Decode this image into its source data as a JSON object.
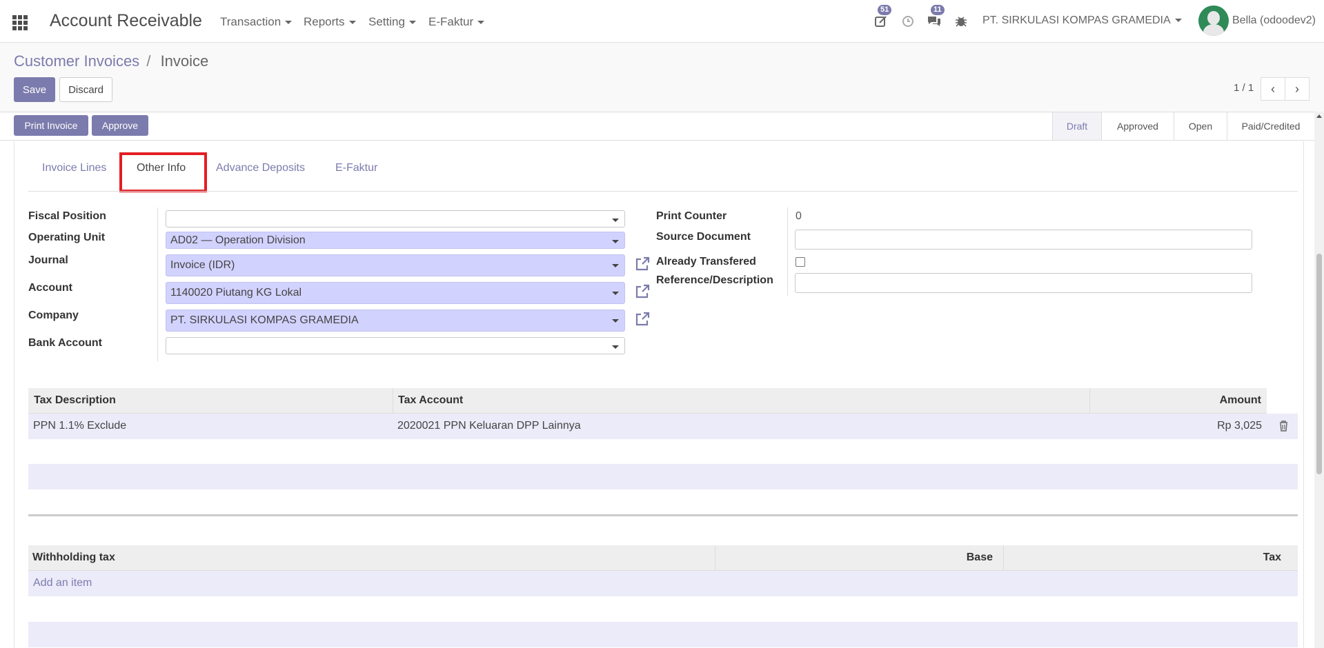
{
  "nav": {
    "app_title": "Account Receivable",
    "menus": [
      "Transaction",
      "Reports",
      "Setting",
      "E-Faktur"
    ],
    "activities_badge": "51",
    "messages_badge": "11",
    "company": "PT. SIRKULASI KOMPAS GRAMEDIA",
    "user": "Bella (odoodev2)"
  },
  "breadcrumb": {
    "parent": "Customer Invoices",
    "separator": "/",
    "current": "Invoice"
  },
  "buttons": {
    "save": "Save",
    "discard": "Discard",
    "print_invoice": "Print Invoice",
    "approve": "Approve"
  },
  "pager": {
    "value": "1 / 1"
  },
  "stages": [
    "Draft",
    "Approved",
    "Open",
    "Paid/Credited"
  ],
  "active_stage": "Draft",
  "tabs": [
    "Invoice Lines",
    "Other Info",
    "Advance Deposits",
    "E-Faktur"
  ],
  "active_tab": "Other Info",
  "form_left": {
    "fiscal_position": {
      "label": "Fiscal Position",
      "value": ""
    },
    "operating_unit": {
      "label": "Operating Unit",
      "value": "AD02 — Operation Division"
    },
    "journal": {
      "label": "Journal",
      "value": "Invoice (IDR)"
    },
    "account": {
      "label": "Account",
      "value": "1140020 Piutang KG Lokal"
    },
    "company": {
      "label": "Company",
      "value": "PT. SIRKULASI KOMPAS GRAMEDIA"
    },
    "bank_account": {
      "label": "Bank Account",
      "value": ""
    }
  },
  "form_right": {
    "print_counter": {
      "label": "Print Counter",
      "value": "0"
    },
    "source_document": {
      "label": "Source Document",
      "value": ""
    },
    "already_transfered": {
      "label": "Already Transfered",
      "checked": false
    },
    "reference": {
      "label": "Reference/Description",
      "value": ""
    }
  },
  "tax_table": {
    "headers": [
      "Tax Description",
      "Tax Account",
      "Amount"
    ],
    "rows": [
      {
        "description": "PPN 1.1% Exclude",
        "account": "2020021 PPN Keluaran DPP Lainnya",
        "amount": "Rp 3,025"
      }
    ]
  },
  "withholding_table": {
    "headers": [
      "Withholding tax",
      "Base",
      "Tax"
    ],
    "add_item": "Add an item"
  },
  "colors": {
    "accent": "#7c7bad",
    "required_field": "#d2d2ff",
    "highlight": "#e31e24"
  }
}
